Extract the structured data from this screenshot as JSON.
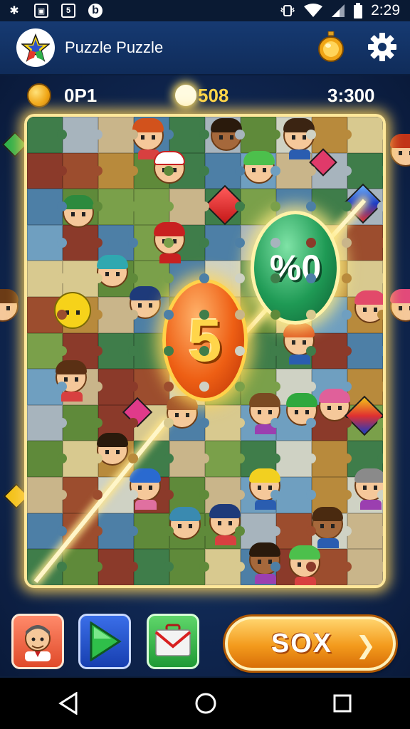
{
  "status_bar": {
    "time": "2:29",
    "left_icons": [
      "settings-icon",
      "image-icon",
      "app-box-icon",
      "browser-icon"
    ],
    "right_icons": [
      "vibrate-icon",
      "wifi-icon",
      "signal-icon",
      "battery-icon"
    ]
  },
  "app_bar": {
    "title": "Puzzle Puzzle",
    "logo_icon": "star-logo-icon",
    "actions": [
      "coin-shop-icon",
      "gear-icon"
    ]
  },
  "hud": {
    "left_value": "0P1",
    "center_value": "508",
    "right_value": "3:300"
  },
  "board": {
    "orange_bubble_label": "5",
    "green_bubble_label": "%0",
    "glow_color": "#ffe79a"
  },
  "bottom_bar": {
    "tools": [
      "character-icon",
      "play-icon",
      "mail-icon"
    ],
    "go_button_label": "SOX",
    "go_button_arrow": "chevron-right-icon"
  },
  "nav_bar": {
    "buttons": [
      "back-icon",
      "home-icon",
      "recents-icon"
    ]
  }
}
